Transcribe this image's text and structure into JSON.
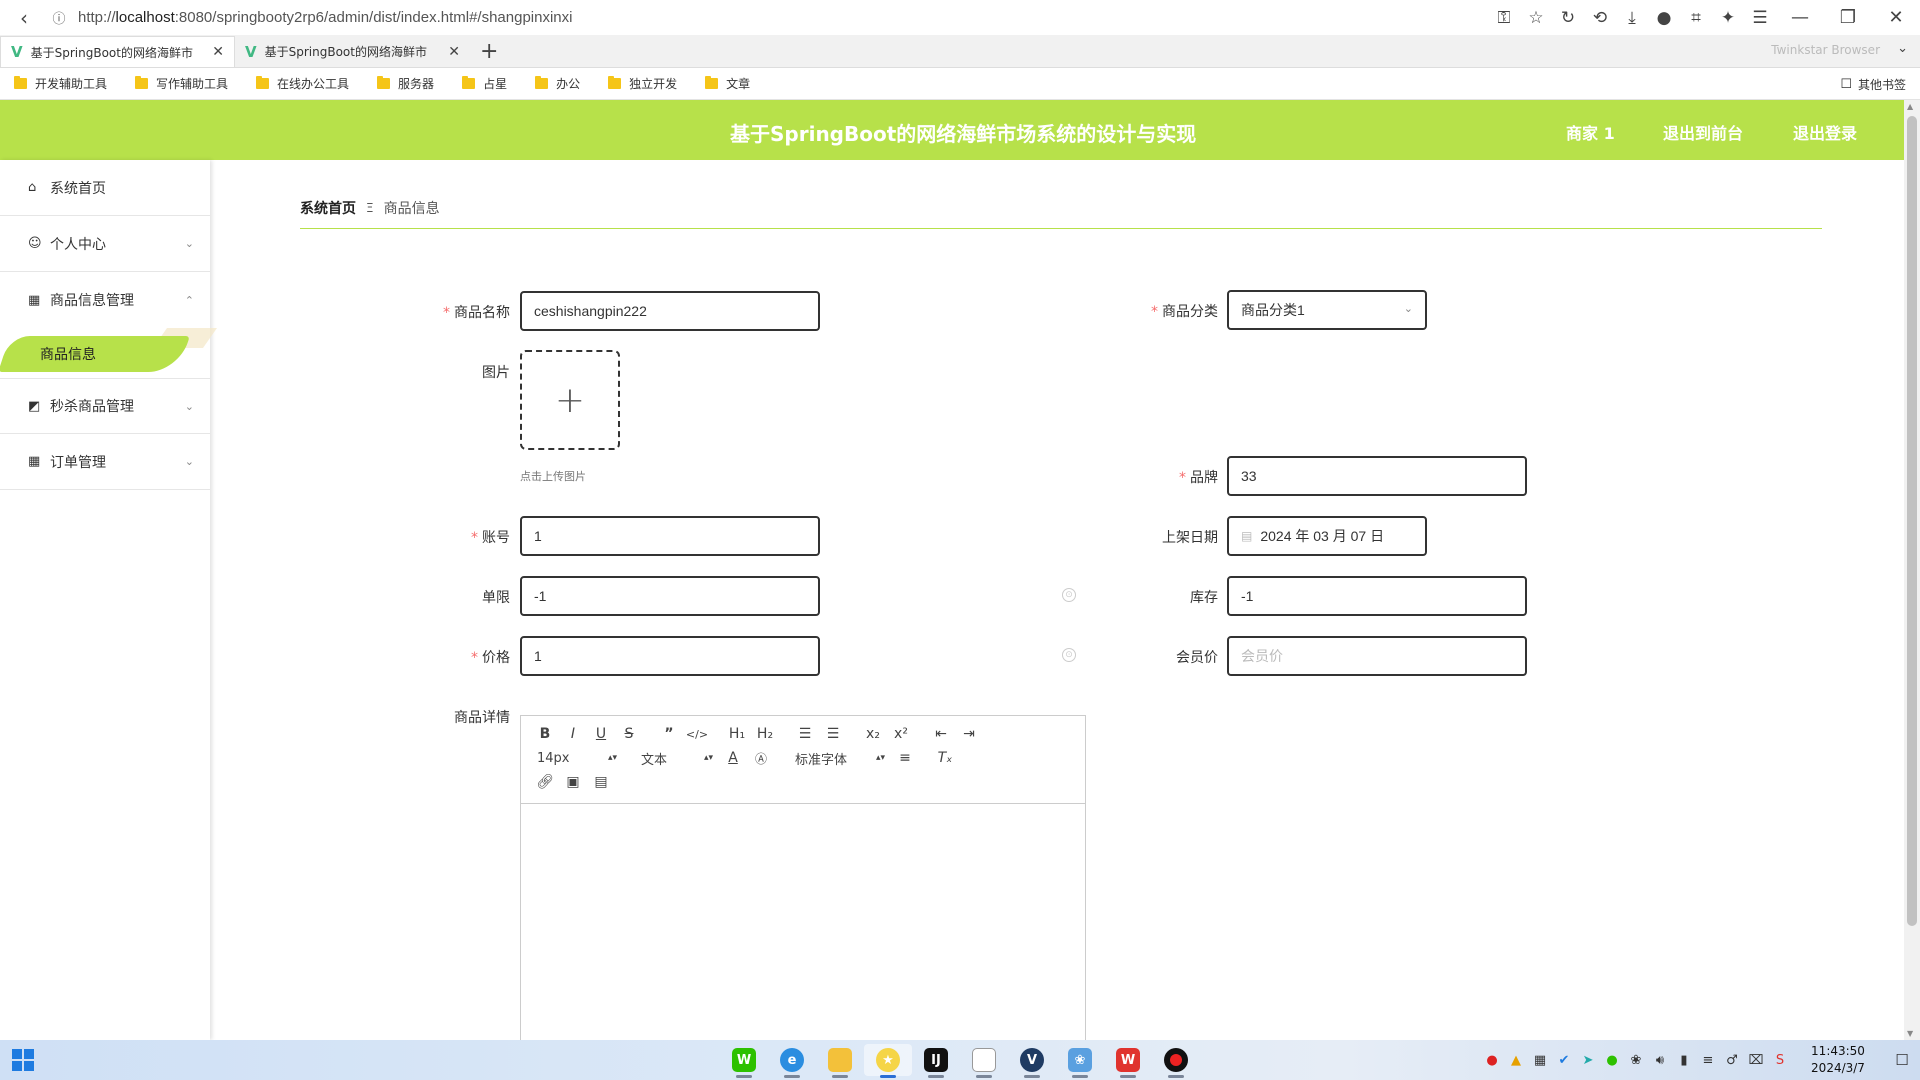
{
  "browser": {
    "url_prefix": "http://",
    "url_host": "localhost",
    "url_rest": ":8080/springbooty2rp6/admin/dist/index.html#/shangpinxinxi",
    "tabs": [
      {
        "title": "基于SpringBoot的网络海鲜市"
      },
      {
        "title": "基于SpringBoot的网络海鲜市"
      }
    ],
    "brand": "Twinkstar Browser",
    "bookmarks": [
      "开发辅助工具",
      "写作辅助工具",
      "在线办公工具",
      "服务器",
      "占星",
      "办公",
      "独立开发",
      "文章"
    ],
    "other_bookmarks": "其他书签"
  },
  "header": {
    "title": "基于SpringBoot的网络海鲜市场系统的设计与实现",
    "user": "商家 1",
    "to_front": "退出到前台",
    "logout": "退出登录"
  },
  "sidebar": {
    "items": [
      {
        "label": "系统首页",
        "icon": "home-icon"
      },
      {
        "label": "个人中心",
        "icon": "user-icon"
      },
      {
        "label": "商品信息管理",
        "icon": "grid-icon"
      },
      {
        "label": "商品信息",
        "icon": ""
      },
      {
        "label": "秒杀商品管理",
        "icon": "chart-icon"
      },
      {
        "label": "订单管理",
        "icon": "grid-icon"
      }
    ]
  },
  "breadcrumb": {
    "home": "系统首页",
    "separator": "Ξ",
    "current": "商品信息"
  },
  "form": {
    "name_label": "商品名称",
    "name_value": "ceshishangpin222",
    "category_label": "商品分类",
    "category_value": "商品分类1",
    "image_label": "图片",
    "upload_hint": "点击上传图片",
    "brand_label": "品牌",
    "brand_value": "33",
    "account_label": "账号",
    "account_value": "1",
    "date_label": "上架日期",
    "date_value": "2024 年 03 月 07 日",
    "limit_label": "单限",
    "limit_value": "-1",
    "stock_label": "库存",
    "stock_value": "-1",
    "price_label": "价格",
    "price_value": "1",
    "member_price_label": "会员价",
    "member_price_placeholder": "会员价",
    "detail_label": "商品详情"
  },
  "editor": {
    "size": "14px",
    "format": "文本",
    "font": "标准字体"
  },
  "taskbar": {
    "time": "11:43:50",
    "date": "2024/3/7"
  },
  "colors": {
    "accent": "#b7e14a",
    "required": "#f56c6c"
  }
}
